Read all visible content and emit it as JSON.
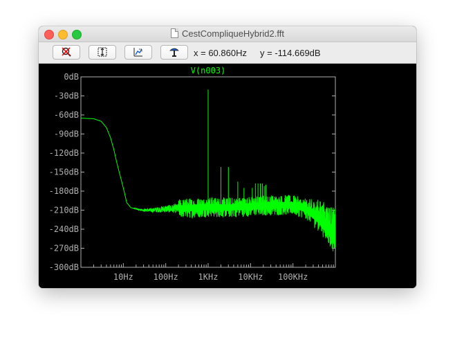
{
  "window": {
    "title": "CestCompliqueHybrid2.fft"
  },
  "toolbar": {
    "buttons": [
      {
        "name": "zoom-cancel",
        "icon": "magnifier-cancel-icon"
      },
      {
        "name": "autorange",
        "icon": "autorange-icon"
      },
      {
        "name": "zoom-back",
        "icon": "zoom-back-icon"
      },
      {
        "name": "pan",
        "icon": "pan-hand-icon"
      }
    ],
    "x_readout": "x = 60.860Hz",
    "y_readout": "y = -114.669dB"
  },
  "chart_data": {
    "type": "line",
    "title": "V(n003)",
    "xscale": "log",
    "xlim": [
      1,
      1000000
    ],
    "ylim": [
      -300,
      0
    ],
    "y_ticks": [
      "0dB",
      "-30dB",
      "-60dB",
      "-90dB",
      "-120dB",
      "-150dB",
      "-180dB",
      "-210dB",
      "-240dB",
      "-270dB",
      "-300dB"
    ],
    "y_tick_values": [
      0,
      -30,
      -60,
      -90,
      -120,
      -150,
      -180,
      -210,
      -240,
      -270,
      -300
    ],
    "x_ticks": [
      "10Hz",
      "100Hz",
      "1KHz",
      "10KHz",
      "100KHz"
    ],
    "x_tick_values": [
      10,
      100,
      1000,
      10000,
      100000
    ],
    "grid": false,
    "line_color": "#00ff00",
    "axis_color": "#b0b0b0",
    "series": [
      {
        "name": "V(n003)",
        "x": [
          1,
          2,
          3,
          4,
          5,
          6,
          7,
          8,
          10,
          12,
          15,
          20,
          30,
          50,
          100,
          300,
          1000,
          3000,
          10000,
          30000,
          100000,
          200000,
          400000,
          700000,
          1000000
        ],
        "y": [
          -65,
          -66,
          -70,
          -80,
          -96,
          -115,
          -135,
          -150,
          -175,
          -198,
          -206,
          -208,
          -210,
          -210,
          -208,
          -207,
          -205,
          -206,
          -204,
          -202,
          -202,
          -208,
          -218,
          -232,
          -245
        ]
      }
    ],
    "spikes": [
      {
        "x": 1000,
        "y": -20
      },
      {
        "x": 2000,
        "y": -142
      },
      {
        "x": 3000,
        "y": -142
      },
      {
        "x": 5000,
        "y": -165
      },
      {
        "x": 7000,
        "y": -175
      },
      {
        "x": 11000,
        "y": -175
      },
      {
        "x": 13000,
        "y": -168
      },
      {
        "x": 15000,
        "y": -168
      },
      {
        "x": 17000,
        "y": -168
      },
      {
        "x": 19000,
        "y": -168
      },
      {
        "x": 21000,
        "y": -172
      },
      {
        "x": 23000,
        "y": -170
      }
    ]
  }
}
